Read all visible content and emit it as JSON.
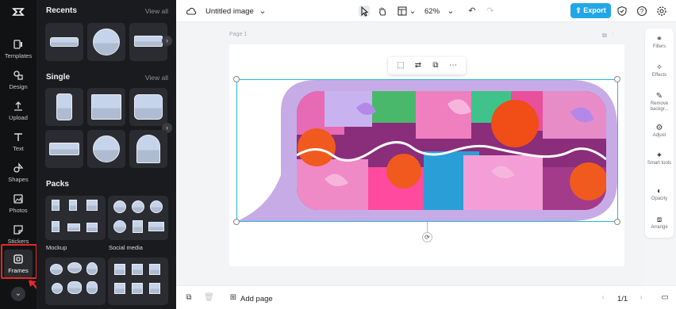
{
  "app": {
    "document_title": "Untitled image",
    "zoom": "62%",
    "export_label": "Export"
  },
  "rail": {
    "items": [
      {
        "label": "Templates",
        "icon": "templates-icon"
      },
      {
        "label": "Design",
        "icon": "design-icon"
      },
      {
        "label": "Upload",
        "icon": "upload-icon"
      },
      {
        "label": "Text",
        "icon": "text-icon"
      },
      {
        "label": "Shapes",
        "icon": "shapes-icon"
      },
      {
        "label": "Photos",
        "icon": "photos-icon"
      },
      {
        "label": "Stickers",
        "icon": "stickers-icon"
      },
      {
        "label": "Frames",
        "icon": "frames-icon"
      }
    ],
    "active": "Frames"
  },
  "panel": {
    "recents_title": "Recents",
    "single_title": "Single",
    "packs_title": "Packs",
    "view_all": "View all",
    "pack_labels": [
      "Mockup",
      "Social media"
    ]
  },
  "canvas": {
    "page_label": "Page 1"
  },
  "right_rail": {
    "items": [
      {
        "label": "Filters",
        "icon": "filters-icon"
      },
      {
        "label": "Effects",
        "icon": "effects-icon"
      },
      {
        "label": "Remove backgr...",
        "icon": "remove-background-icon"
      },
      {
        "label": "Adjust",
        "icon": "adjust-icon"
      },
      {
        "label": "Smart tools",
        "icon": "smart-tools-icon"
      },
      {
        "label": "Opacity",
        "icon": "opacity-icon"
      },
      {
        "label": "Arrange",
        "icon": "arrange-icon"
      }
    ]
  },
  "bottom": {
    "add_page": "Add page",
    "page_counter": "1/1"
  },
  "colors": {
    "accent": "#21a7e8",
    "frame_fill": "#c7abe6",
    "selection": "#26b8d8",
    "highlight": "#e52a2a"
  }
}
